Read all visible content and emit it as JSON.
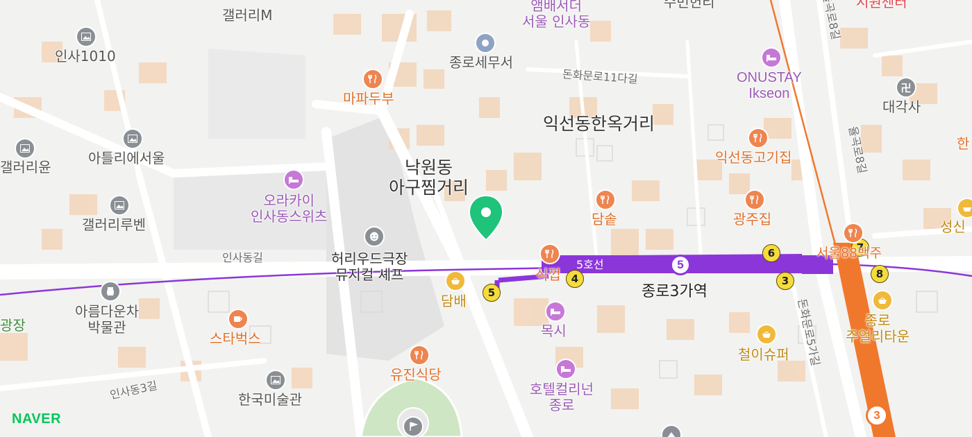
{
  "map": {
    "provider_logo": "NAVER",
    "colors": {
      "line5": "#8b36d9",
      "line3": "#f0782d",
      "building": "#f3d8c0",
      "block": "#e6e6e6",
      "road": "#ffffff",
      "marker": "#1fc37a"
    },
    "area_labels": [
      "익선동한옥거리",
      "낙원동\n아구찜거리"
    ],
    "road_labels": [
      "인사동길",
      "돈화문로11다길",
      "돈화문로5가길",
      "인사동3길",
      "율곡로8길",
      "율곡로8길"
    ],
    "station": {
      "name": "종로3가역",
      "line5_label": "5호선",
      "line5_number": "5",
      "line3_number": "3"
    },
    "exits": [
      "6",
      "4",
      "5",
      "3",
      "7",
      "8"
    ],
    "pois": [
      {
        "name": "갤러리M",
        "category": "gallery-icon"
      },
      {
        "name": "인사1010",
        "category": "gallery-icon"
      },
      {
        "name": "갤러리윤",
        "category": "gallery-icon"
      },
      {
        "name": "아틀리에서울",
        "category": "gallery-icon"
      },
      {
        "name": "갤러리루벤",
        "category": "gallery-icon"
      },
      {
        "name": "오라카이\n인사동스위츠",
        "category": "hotel-icon"
      },
      {
        "name": "허리우드극장\n뮤지컬 셰프",
        "category": "theater-icon"
      },
      {
        "name": "아름다운차\n박물관",
        "category": "museum-icon"
      },
      {
        "name": "스타벅스",
        "category": "cafe-icon"
      },
      {
        "name": "한국미술관",
        "category": "gallery-icon"
      },
      {
        "name": "마파두부",
        "category": "restaurant-icon"
      },
      {
        "name": "종로세무서",
        "category": "office-icon"
      },
      {
        "name": "앰배서더\n서울 인사동",
        "category": "hotel-icon"
      },
      {
        "name": "ONUSTAY\nIkseon",
        "category": "hotel-icon"
      },
      {
        "name": "대각사",
        "category": "temple-icon"
      },
      {
        "name": "익선동고기집",
        "category": "restaurant-icon"
      },
      {
        "name": "광주집",
        "category": "restaurant-icon"
      },
      {
        "name": "담솥",
        "category": "restaurant-icon"
      },
      {
        "name": "식껍",
        "category": "restaurant-icon"
      },
      {
        "name": "담배",
        "category": "shop-icon"
      },
      {
        "name": "목시",
        "category": "hotel-icon"
      },
      {
        "name": "유진식당",
        "category": "restaurant-icon"
      },
      {
        "name": "호텔컬리넌\n종로",
        "category": "hotel-icon"
      },
      {
        "name": "철이슈퍼",
        "category": "shop-icon"
      },
      {
        "name": "종로\n주얼리타운",
        "category": "shop-icon"
      },
      {
        "name": "서울88백주",
        "category": "restaurant-icon"
      },
      {
        "name": "성신",
        "category": "shop-icon"
      },
      {
        "name": "시원센터",
        "category": "shop-icon"
      },
      {
        "name": "수번헌리",
        "category": "shop-icon"
      },
      {
        "name": "한",
        "category": "shop-icon"
      },
      {
        "name": "인사동길",
        "category": "road"
      },
      {
        "name": "광장",
        "category": "park"
      }
    ]
  }
}
